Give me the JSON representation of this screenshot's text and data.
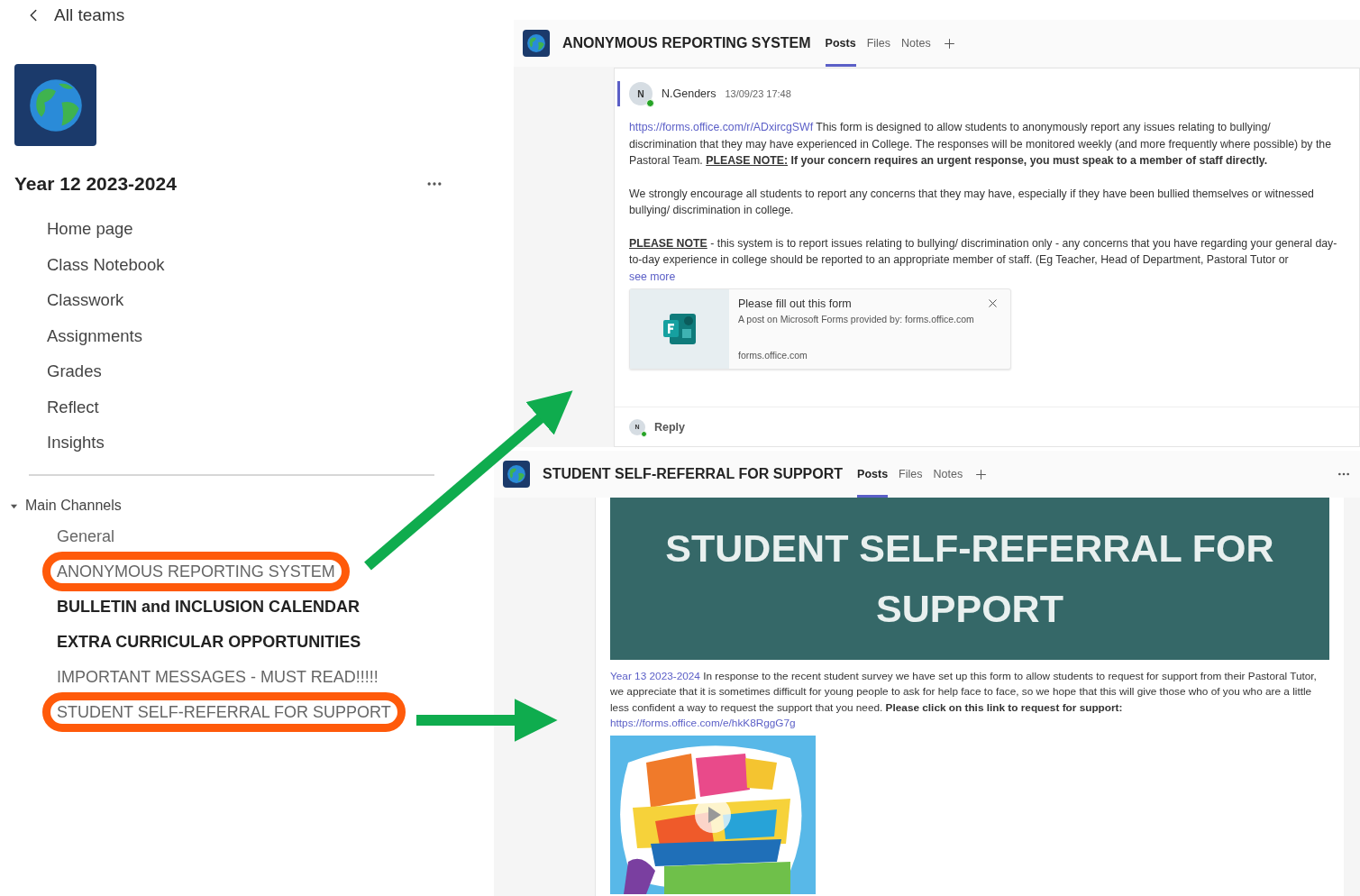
{
  "sidebar": {
    "back_label": "All teams",
    "team_name": "Year 12 2023-2024",
    "nav_items": [
      "Home page",
      "Class Notebook",
      "Classwork",
      "Assignments",
      "Grades",
      "Reflect",
      "Insights"
    ],
    "section": {
      "label": "Main Channels",
      "expanded": true,
      "channels": [
        {
          "name": "General",
          "unread": false,
          "circled": false
        },
        {
          "name": "ANONYMOUS REPORTING SYSTEM",
          "unread": false,
          "circled": true
        },
        {
          "name": "BULLETIN and INCLUSION CALENDAR",
          "unread": true,
          "circled": false
        },
        {
          "name": "EXTRA CURRICULAR OPPORTUNITIES",
          "unread": true,
          "circled": false
        },
        {
          "name": "IMPORTANT MESSAGES - MUST READ!!!!!",
          "unread": false,
          "circled": false
        },
        {
          "name": "STUDENT SELF-REFERRAL FOR SUPPORT",
          "unread": false,
          "circled": true
        }
      ]
    }
  },
  "channel_views": [
    {
      "title": "ANONYMOUS REPORTING SYSTEM",
      "more_menu": false,
      "tabs": [
        {
          "label": "Posts",
          "selected": true
        },
        {
          "label": "Files",
          "selected": false
        },
        {
          "label": "Notes",
          "selected": false
        }
      ],
      "post": {
        "kind": "message",
        "avatar_initial": "N",
        "online": true,
        "author": "N.Genders",
        "time": "13/09/23 17:48",
        "paragraphs": [
          [
            {
              "kind": "link",
              "text": "https://forms.office.com/r/ADxircgSWf"
            },
            {
              "kind": "text",
              "text": " This form is designed to allow students to anonymously report any issues relating to bullying/ discrimination that they may have experienced in College. The responses will be monitored weekly (and more frequently where possible) by the Pastoral Team. "
            },
            {
              "kind": "note",
              "text": "PLEASE NOTE:"
            },
            {
              "kind": "bold",
              "text": " If your concern requires an urgent response, you must speak to a member of staff directly."
            }
          ],
          [
            {
              "kind": "text",
              "text": "We strongly encourage all students to report any concerns that they may have, especially if they have been bullied themselves or witnessed bullying/ discrimination in college."
            }
          ],
          [
            {
              "kind": "note",
              "text": "PLEASE NOTE"
            },
            {
              "kind": "text",
              "text": " - this system is to report issues relating to bullying/ discrimination only - any concerns that you have regarding your general day-to-day experience in college should be reported to an appropriate member of staff. (Eg Teacher, Head of Department, Pastoral Tutor or"
            }
          ]
        ],
        "see_more": "see more",
        "link_preview": {
          "title": "Please fill out this form",
          "subtitle": "A post on Microsoft Forms provided by: forms.office.com",
          "domain": "forms.office.com"
        },
        "reply": {
          "avatar_initial": "N",
          "label": "Reply"
        }
      }
    },
    {
      "title": "STUDENT SELF-REFERRAL FOR SUPPORT",
      "more_menu": true,
      "tabs": [
        {
          "label": "Posts",
          "selected": true
        },
        {
          "label": "Files",
          "selected": false
        },
        {
          "label": "Notes",
          "selected": false
        }
      ],
      "post": {
        "kind": "banner",
        "banner_title": "STUDENT SELF-REFERRAL FOR SUPPORT",
        "paragraphs": [
          [
            {
              "kind": "link",
              "text": "Year 13 2023-2024"
            },
            {
              "kind": "text",
              "text": " In response to the recent student survey we have set up this form to allow students to request for support from their Pastoral Tutor, we appreciate that it is sometimes difficult for young people to ask for help face to face, so we hope that this will give those who of you who are a little less confident a way to request the support that you need. "
            },
            {
              "kind": "bold",
              "text": "Please click on this link to request for support:"
            },
            {
              "kind": "link_line",
              "text": "https://forms.office.com/e/hkK8RggG7g"
            }
          ]
        ]
      }
    }
  ]
}
